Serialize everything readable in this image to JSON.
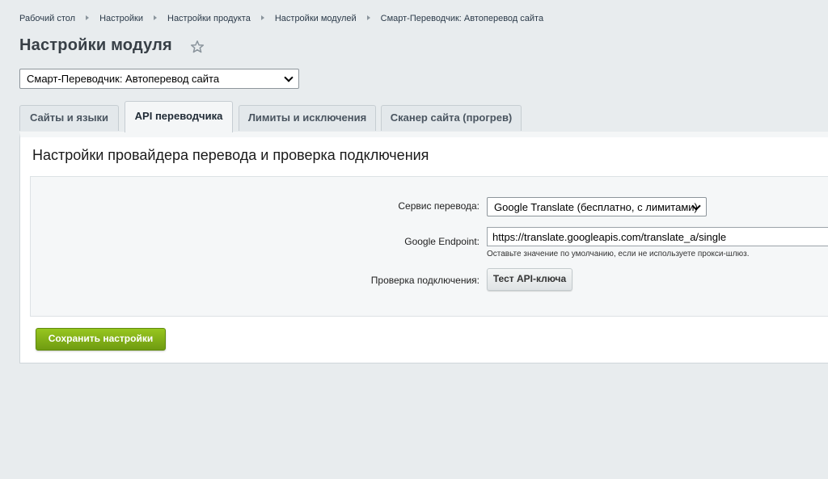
{
  "breadcrumb": {
    "items": [
      "Рабочий стол",
      "Настройки",
      "Настройки продукта",
      "Настройки модулей",
      "Смарт-Переводчик: Автоперевод сайта"
    ]
  },
  "header": {
    "title": "Настройки модуля"
  },
  "module_select": {
    "value": "Смарт-Переводчик: Автоперевод сайта"
  },
  "tabs": [
    {
      "label": "Сайты и языки",
      "active": false
    },
    {
      "label": "API переводчика",
      "active": true
    },
    {
      "label": "Лимиты и исключения",
      "active": false
    },
    {
      "label": "Сканер сайта (прогрев)",
      "active": false
    }
  ],
  "panel": {
    "title": "Настройки провайдера перевода и проверка подключения",
    "fields": {
      "service": {
        "label": "Сервис перевода:",
        "value": "Google Translate (бесплатно, с лимитами)"
      },
      "endpoint": {
        "label": "Google Endpoint:",
        "value": "https://translate.googleapis.com/translate_a/single",
        "hint": "Оставьте значение по умолчанию, если не используете прокси-шлюз."
      },
      "check": {
        "label": "Проверка подключения:",
        "button_label": "Тест API-ключа"
      }
    },
    "save_label": "Сохранить настройки"
  },
  "colors": {
    "background": "#e8ecee",
    "save_button": "#86b51a",
    "panel": "#ffffff"
  }
}
